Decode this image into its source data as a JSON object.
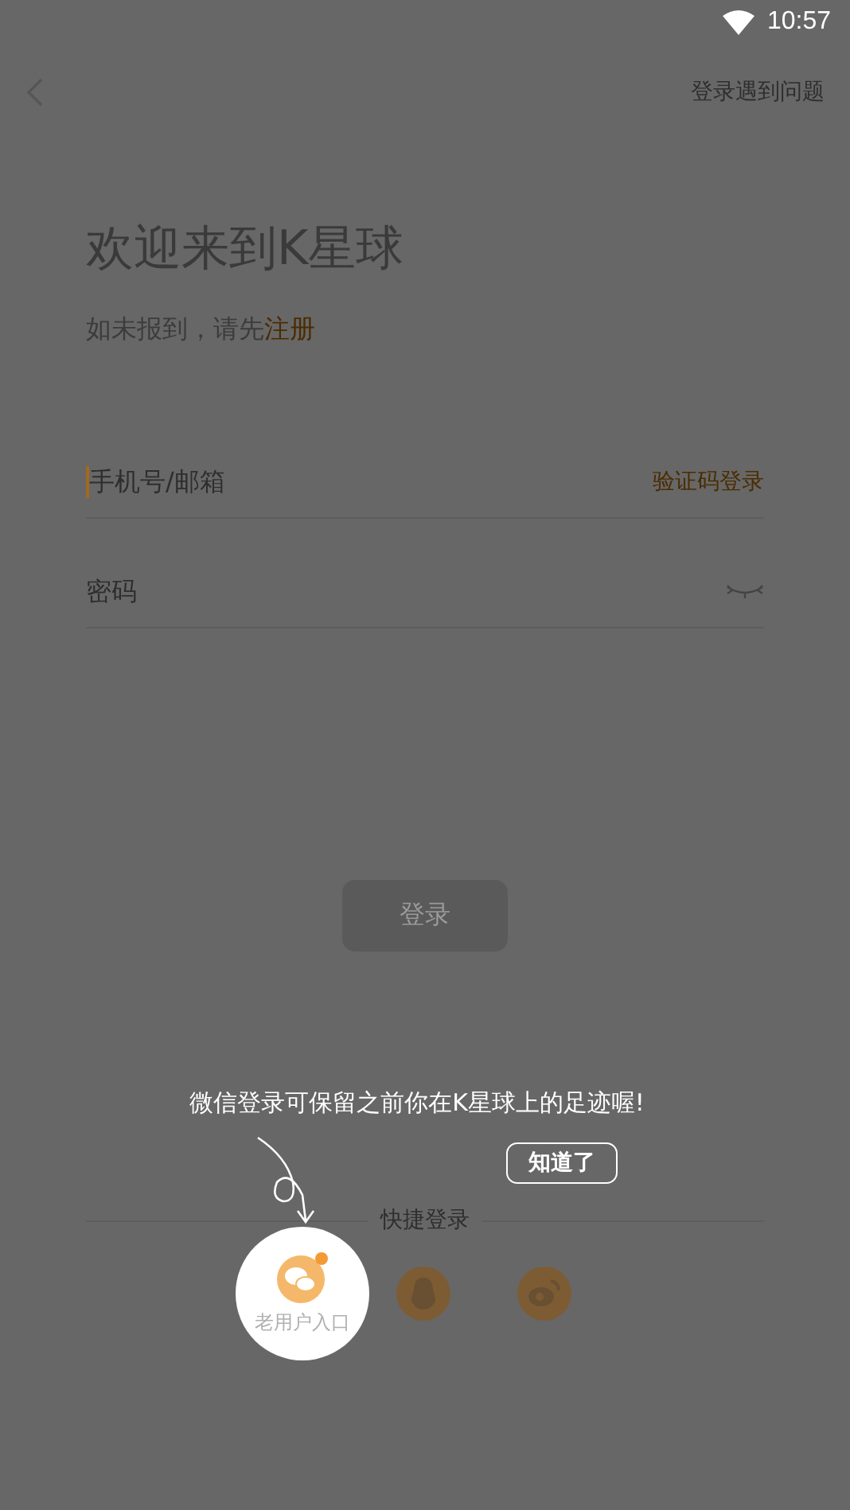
{
  "status_bar": {
    "time": "10:57"
  },
  "nav": {
    "help_link": "登录遇到问题"
  },
  "title": "欢迎来到K星球",
  "subtitle": {
    "text": "如未报到，请先",
    "link": "注册"
  },
  "fields": [
    {
      "kind": "account",
      "placeholder": "手机号/邮箱",
      "focused": true,
      "action": "验证码登录"
    },
    {
      "kind": "password",
      "placeholder": "密码",
      "focused": false
    }
  ],
  "login_button": {
    "label": "登录",
    "disabled": true
  },
  "tip": {
    "text": "微信登录可保留之前你在K星球上的足迹喔!",
    "button": "知道了"
  },
  "quick_login": {
    "label": "快捷登录",
    "options": [
      {
        "kind": "wechat",
        "highlighted": true,
        "label": "老用户入口"
      },
      {
        "kind": "qq",
        "highlighted": false
      },
      {
        "kind": "weibo",
        "highlighted": false
      }
    ]
  }
}
